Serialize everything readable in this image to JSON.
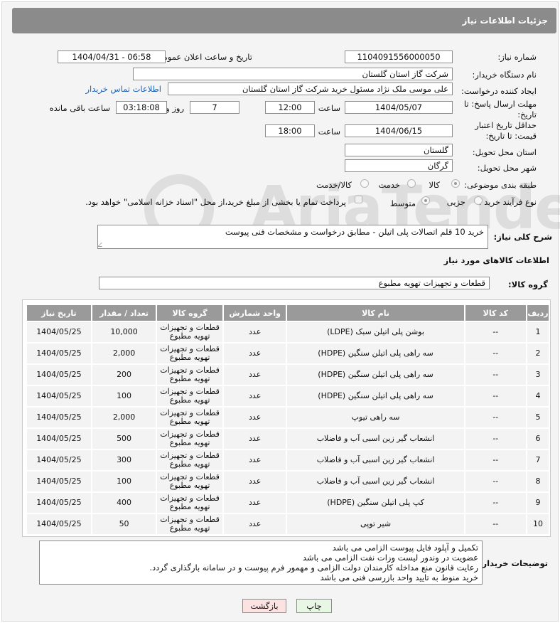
{
  "header": {
    "title": "جزئیات اطلاعات نیاز"
  },
  "form": {
    "need_number_label": "شماره نیاز:",
    "need_number": "1104091556000050",
    "announce_label": "تاریخ و ساعت اعلان عمومی:",
    "announce_value": "1404/04/31 - 06:58",
    "buyer_org_label": "نام دستگاه خریدار:",
    "buyer_org": "شرکت گاز استان گلستان",
    "creator_label": "ایجاد کننده درخواست:",
    "creator": "علی موسی ملک نژاد مسئول خرید شرکت گاز استان گلستان",
    "contact_link": "اطلاعات تماس خریدار",
    "reply_deadline_label": "مهلت ارسال پاسخ: تا تاریخ:",
    "reply_date": "1404/05/07",
    "time_label": "ساعت",
    "reply_time": "12:00",
    "days_value": "7",
    "days_label": "روز و",
    "remaining_value": "03:18:08",
    "remaining_label": "ساعت باقی مانده",
    "price_validity_label": "حداقل تاریخ اعتبار قیمت: تا تاریخ:",
    "price_date": "1404/06/15",
    "price_time": "18:00",
    "province_label": "استان محل تحویل:",
    "province": "گلستان",
    "city_label": "شهر محل تحویل:",
    "city": "گرگان",
    "category_label": "طبقه بندی موضوعی:",
    "category_options": [
      "کالا",
      "خدمت",
      "کالا/خدمت"
    ],
    "process_label": "نوع فرآیند خرید :",
    "process_options": [
      "جزیی",
      "متوسط"
    ],
    "payment_note": "پرداخت تمام یا بخشی از مبلغ خرید،از محل \"اسناد خزانه اسلامی\" خواهد بود.",
    "description_label": "شرح کلی نیاز:",
    "description": "خرید 10 قلم اتصالات پلی اتیلن - مطابق درخواست و مشخصات فنی پیوست",
    "goods_info_title": "اطلاعات کالاهای مورد نیاز",
    "goods_group_label": "گروه کالا:",
    "goods_group": "قطعات و تجهیزات تهویه مطبوع"
  },
  "table": {
    "headers": [
      "ردیف",
      "کد کالا",
      "نام کالا",
      "واحد شمارش",
      "گروه کالا",
      "تعداد / مقدار",
      "تاریخ نیاز"
    ],
    "rows": [
      [
        "1",
        "--",
        "بوشن پلی اتیلن سبک (LDPE)",
        "عدد",
        "قطعات و تجهیزات تهویه مطبوع",
        "10,000",
        "1404/05/25"
      ],
      [
        "2",
        "--",
        "سه راهی پلی اتیلن سنگین (HDPE)",
        "عدد",
        "قطعات و تجهیزات تهویه مطبوع",
        "2,000",
        "1404/05/25"
      ],
      [
        "3",
        "--",
        "سه راهی پلی اتیلن سنگین (HDPE)",
        "عدد",
        "قطعات و تجهیزات تهویه مطبوع",
        "200",
        "1404/05/25"
      ],
      [
        "4",
        "--",
        "سه راهی پلی اتیلن سنگین (HDPE)",
        "عدد",
        "قطعات و تجهیزات تهویه مطبوع",
        "100",
        "1404/05/25"
      ],
      [
        "5",
        "--",
        "سه راهی تیوپ",
        "عدد",
        "قطعات و تجهیزات تهویه مطبوع",
        "2,000",
        "1404/05/25"
      ],
      [
        "6",
        "--",
        "انشعاب گیر زین اسبی آب و فاضلاب",
        "عدد",
        "قطعات و تجهیزات تهویه مطبوع",
        "500",
        "1404/05/25"
      ],
      [
        "7",
        "--",
        "انشعاب گیر زین اسبی آب و فاضلاب",
        "عدد",
        "قطعات و تجهیزات تهویه مطبوع",
        "300",
        "1404/05/25"
      ],
      [
        "8",
        "--",
        "انشعاب گیر زین اسبی آب و فاضلاب",
        "عدد",
        "قطعات و تجهیزات تهویه مطبوع",
        "100",
        "1404/05/25"
      ],
      [
        "9",
        "--",
        "کپ پلی اتیلن سنگین (HDPE)",
        "عدد",
        "قطعات و تجهیزات تهویه مطبوع",
        "400",
        "1404/05/25"
      ],
      [
        "10",
        "--",
        "شیر توپی",
        "عدد",
        "قطعات و تجهیزات تهویه مطبوع",
        "50",
        "1404/05/25"
      ]
    ]
  },
  "buyer_notes": {
    "label": "توضیحات خریدار:",
    "lines": [
      "تکمیل و آپلود فایل پیوست الزامی می باشد",
      "عضویت در وندور لیست وزات نفت  الزامی می باشد",
      "رعایت قانون منع مداخله کارمندان دولت الزامی و مهمور فرم پیوست و در سامانه بارگذاری گردد.",
      "خرید منوط به تایید واحد بازرسی فنی می باشد"
    ]
  },
  "buttons": {
    "print": "چاپ",
    "back": "بازگشت"
  },
  "watermark": {
    "text": "AriaTender.net"
  },
  "colors": {
    "header_bg": "#8b8b8b",
    "table_header_bg": "#9a9a9a",
    "link": "#1a5fb4",
    "back_button_bg": "#fde2e2",
    "print_button_bg": "#e8f7e3"
  }
}
